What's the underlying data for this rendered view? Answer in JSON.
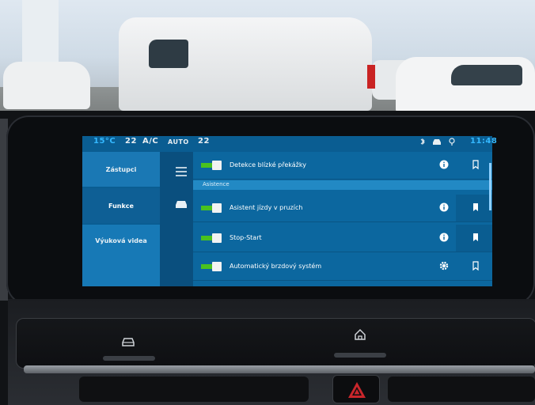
{
  "status_bar": {
    "temperature": "15°C",
    "fan_left": "22",
    "ac": "A/C",
    "auto": "AUTO",
    "fan_right": "22",
    "clock": "11:48",
    "icons": [
      "bluetooth-icon",
      "car-status-icon",
      "gps-icon"
    ]
  },
  "sidebar": {
    "items": [
      {
        "label": "Zástupci",
        "selected": false
      },
      {
        "label": "Funkce",
        "selected": true
      },
      {
        "label": "Výuková videa",
        "selected": false
      }
    ]
  },
  "rail": {
    "icons": [
      "menu-icon",
      "car-icon"
    ]
  },
  "settings": {
    "section_title": "Asistence",
    "rows": [
      {
        "label": "Detekce blízké překážky",
        "enabled": true,
        "icon_a": "info-icon",
        "icon_b": "bookmark-outline-icon"
      },
      {
        "label": "Asistent jízdy v pruzích",
        "enabled": true,
        "icon_a": "info-icon",
        "icon_b": "bookmark-filled-icon"
      },
      {
        "label": "Stop-Start",
        "enabled": true,
        "icon_a": "info-icon",
        "icon_b": "bookmark-filled-icon"
      },
      {
        "label": "Automatický brzdový systém",
        "enabled": true,
        "icon_a": "gear-icon",
        "icon_b": "bookmark-outline-icon"
      }
    ]
  },
  "colors": {
    "screen_bg": "#0c679f",
    "toggle_on": "#49c21f",
    "accent_text": "#34b8ff"
  }
}
